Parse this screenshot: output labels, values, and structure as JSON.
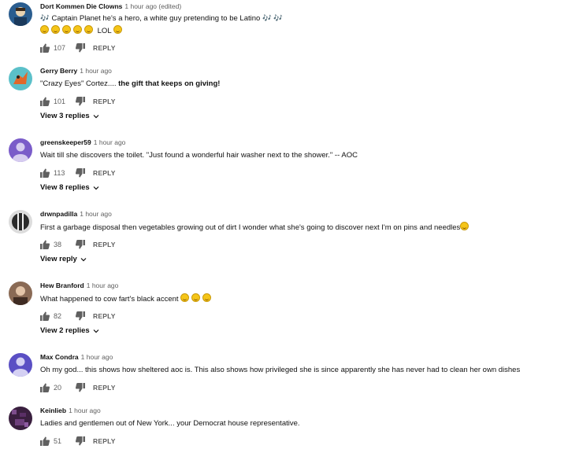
{
  "reply_label": "REPLY",
  "comments": [
    {
      "author": "Dort Kommen Die Clowns",
      "time": "1 hour ago (edited)",
      "text_line1": "🎶 Captain Planet he's a hero, a white guy pretending to be Latino 🎶 🎶",
      "text_line2": "LOL",
      "likes": "107",
      "avatar_color": "#2a5d8f"
    },
    {
      "author": "Gerry Berry",
      "time": "1 hour ago",
      "text_plain": "\"Crazy Eyes\" Cortez....",
      "text_bold": " the gift that keeps on giving!",
      "likes": "101",
      "replies": "View 3 replies",
      "avatar_color": "#5bc0c9"
    },
    {
      "author": "greenskeeper59",
      "time": "1 hour ago",
      "text": "Wait till she discovers the toilet. \"Just found a wonderful hair washer next to the shower.\" -- AOC",
      "likes": "113",
      "replies": "View 8 replies",
      "avatar_color": "#7a5cc9"
    },
    {
      "author": "drwnpadilla",
      "time": "1 hour ago",
      "text": "First a garbage disposal then vegetables growing out of dirt I wonder what she's going to discover next I'm on pins and needles",
      "likes": "38",
      "replies": "View reply",
      "avatar_color": "#2b2b2b"
    },
    {
      "author": "Hew Branford",
      "time": "1 hour ago",
      "text": "What happened to cow fart's  black accent",
      "likes": "82",
      "replies": "View 2 replies",
      "avatar_color": "#6b4a3a"
    },
    {
      "author": "Max Condra",
      "time": "1 hour ago",
      "text": "Oh my god... this shows how sheltered aoc is. This also shows how privileged she is since apparently she has never had to clean her own dishes",
      "likes": "20",
      "avatar_color": "#5a4fc4"
    },
    {
      "author": "Keinlieb",
      "time": "1 hour ago",
      "text": "Ladies and gentlemen out of New York... your Democrat house representative.",
      "likes": "51",
      "avatar_color": "#3a1f3f"
    }
  ]
}
